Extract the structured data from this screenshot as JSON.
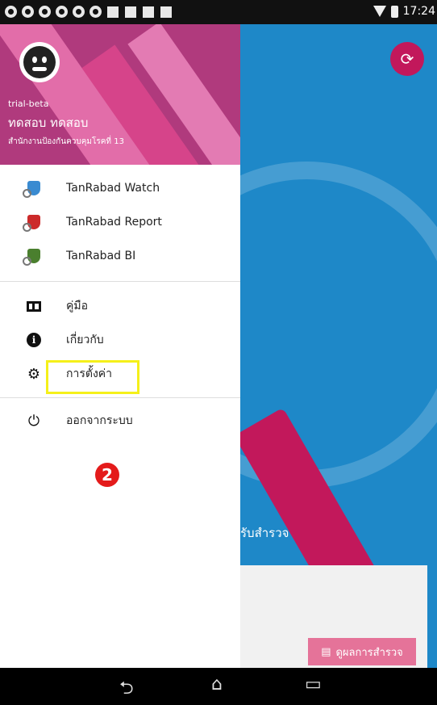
{
  "status_bar": {
    "time": "17:24"
  },
  "header": {
    "line1": "trial-beta",
    "user_name": "ทดสอบ ทดสอบ",
    "organization": "สำนักงานป้องกันควบคุมโรคที่ 13"
  },
  "apps": [
    {
      "label": "TanRabad Watch",
      "icon": "shield-watch-icon",
      "color": "#3a8bd1"
    },
    {
      "label": "TanRabad Report",
      "icon": "shield-report-icon",
      "color": "#cc2a2a"
    },
    {
      "label": "TanRabad BI",
      "icon": "shield-bi-icon",
      "color": "#4a7f2e"
    }
  ],
  "menu": [
    {
      "label": "คู่มือ",
      "icon": "book-icon"
    },
    {
      "label": "เกี่ยวกับ",
      "icon": "info-icon"
    },
    {
      "label": "การตั้งค่า",
      "icon": "gear-icon"
    }
  ],
  "logout": {
    "label": "ออกจากระบบ",
    "icon": "power-icon"
  },
  "annotation": {
    "step": "2",
    "highlight_color": "#f5f01a"
  },
  "background_app": {
    "survey_text": "รับสำรวจ",
    "result_button": "ดูผลการสำรวจ"
  },
  "colors": {
    "accent": "#c2185b",
    "background": "#1e88c8"
  }
}
